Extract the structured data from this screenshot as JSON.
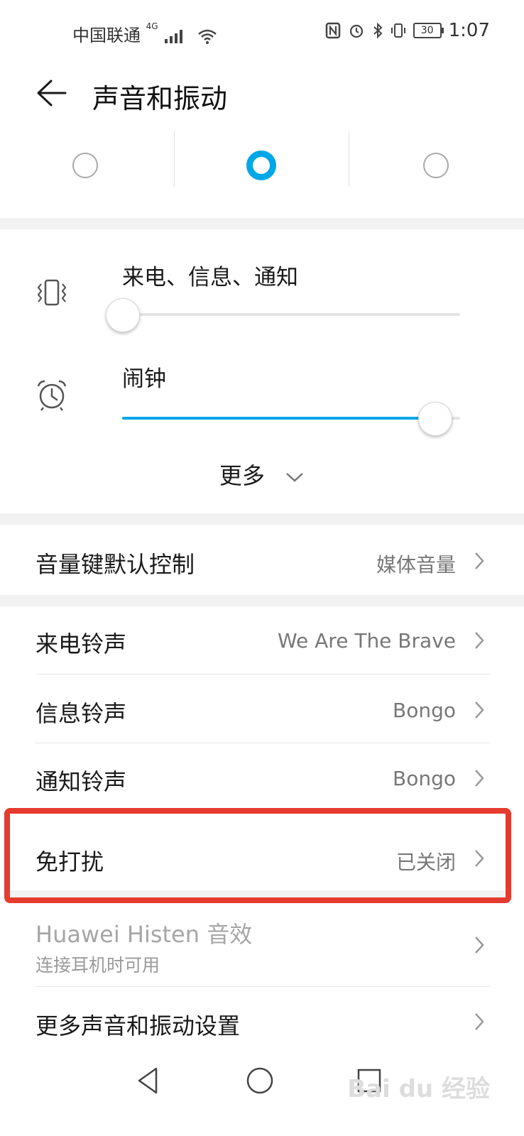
{
  "status_bar": {
    "carrier": "中国联通",
    "network": "4G",
    "battery": "30",
    "time": "1:07"
  },
  "header": {
    "title": "声音和振动"
  },
  "sound_modes": {
    "selected_index": 1,
    "accent_color": "#00a7e8"
  },
  "volume": {
    "ringer_label": "来电、信息、通知",
    "ringer_level": 0,
    "alarm_label": "闹钟",
    "alarm_level": 1.0,
    "more_label": "更多"
  },
  "settings": {
    "volume_key": {
      "label": "音量键默认控制",
      "value": "媒体音量"
    },
    "ringtone": {
      "label": "来电铃声",
      "value": "We Are The Brave"
    },
    "message_tone": {
      "label": "信息铃声",
      "value": "Bongo"
    },
    "notification_tone": {
      "label": "通知铃声",
      "value": "Bongo"
    },
    "dnd": {
      "label": "免打扰",
      "value": "已关闭"
    },
    "histen": {
      "label": "Huawei Histen 音效",
      "sub": "连接耳机时可用"
    },
    "more_settings": {
      "label": "更多声音和振动设置"
    }
  },
  "highlight_color": "#e53b2e",
  "watermark": "Bai du 经验"
}
